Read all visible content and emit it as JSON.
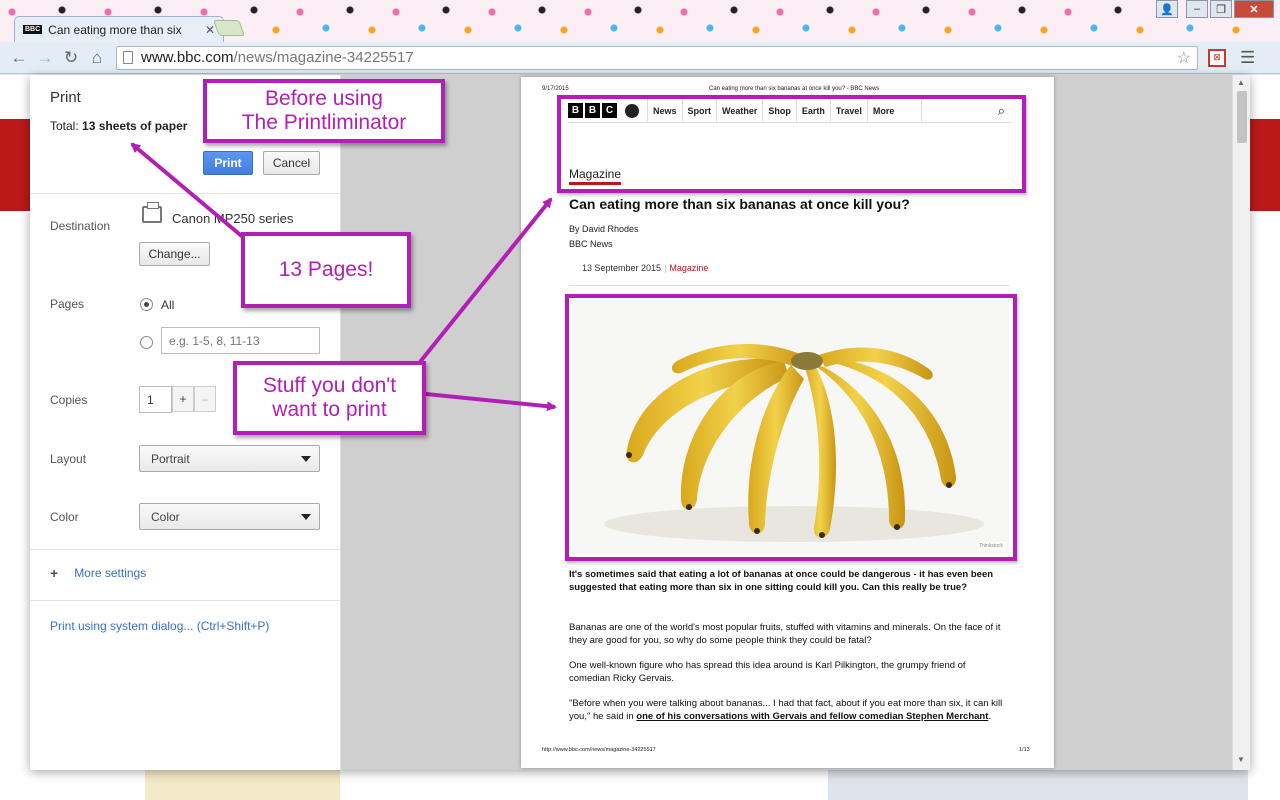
{
  "browser": {
    "tab_title": "Can eating more than six",
    "tab_favicon": "BBC",
    "url_host": "www.bbc.com",
    "url_path": "/news/magazine-34225517"
  },
  "print_panel": {
    "title": "Print",
    "total_label": "Total:",
    "total_value": "13 sheets of paper",
    "print_button": "Print",
    "cancel_button": "Cancel",
    "destination_label": "Destination",
    "printer_name": "Canon MP250 series",
    "change_button": "Change...",
    "pages_label": "Pages",
    "pages_all": "All",
    "pages_placeholder": "e.g. 1-5, 8, 11-13",
    "copies_label": "Copies",
    "copies_value": "1",
    "copies_plus": "+",
    "copies_minus": "–",
    "layout_label": "Layout",
    "layout_value": "Portrait",
    "color_label": "Color",
    "color_value": "Color",
    "more_settings": "More settings",
    "system_dialog": "Print using system dialog... (Ctrl+Shift+P)"
  },
  "preview": {
    "header_date": "9/17/2015",
    "header_title": "Can eating more than six bananas at once kill you? - BBC News",
    "nav_items": [
      "News",
      "Sport",
      "Weather",
      "Shop",
      "Earth",
      "Travel",
      "More"
    ],
    "section": "Magazine",
    "headline": "Can eating more than six bananas at once kill you?",
    "byline": "By David Rhodes",
    "source": "BBC News",
    "date": "13 September 2015",
    "date_section": "Magazine",
    "photo_credit": "Thinkstock",
    "lead": "It's sometimes said that eating a lot of bananas at once could be dangerous - it has even been suggested that eating more than six in one sitting could kill you. Can this really be true?",
    "para1": "Bananas are one of the world's most popular fruits, stuffed with vitamins and minerals. On the face of it they are good for you, so why do some people think they could be fatal?",
    "para2": "One well-known figure who has spread this idea around is Karl Pilkington, the grumpy friend of comedian Ricky Gervais.",
    "para3_a": "\"Before when you were talking about bananas... I had that fact, about if you eat more than six, it can kill you,\" he said in",
    "para3_link": "one of his conversations with Gervais and fellow comedian Stephen Merchant",
    "para3_end": ".",
    "footer_url": "http://www.bbc.com/news/magazine-34225517",
    "footer_page": "1/13"
  },
  "annotations": {
    "before_line1": "Before using",
    "before_line2": "The Printliminator",
    "pages_note": "13 Pages!",
    "stuff_line1": "Stuff you don't",
    "stuff_line2": "want to print",
    "color": "#b21fb5"
  }
}
